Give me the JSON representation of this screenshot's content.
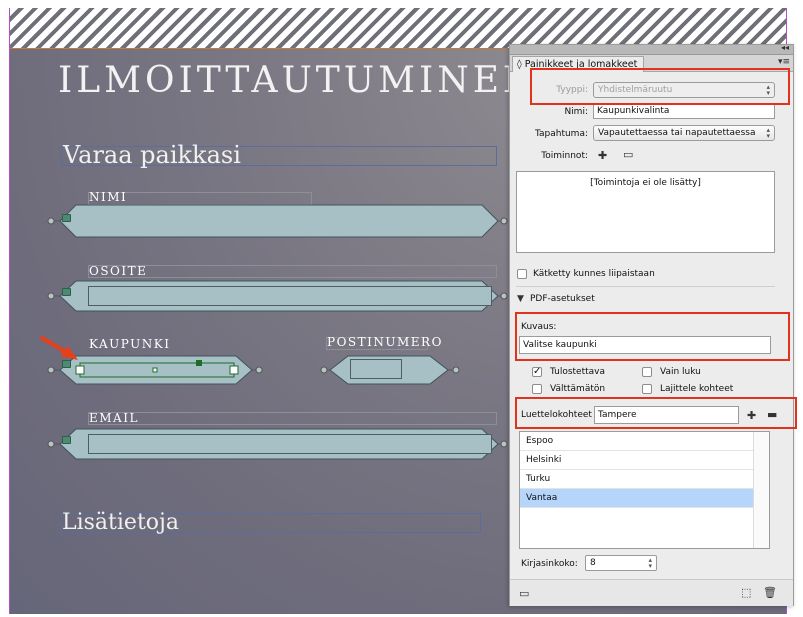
{
  "document": {
    "title": "ILMOITTAUTUMINEN",
    "section_reserve": "Varaa paikkasi",
    "section_more": "Lisätietoja",
    "fields": {
      "name": "NIMI",
      "address": "OSOITE",
      "city": "KAUPUNKI",
      "postal": "POSTINUMERO",
      "email": "EMAIL"
    }
  },
  "panel": {
    "collapse_glyph": "◂◂",
    "tab_label": "◊ Painikkeet ja lomakkeet",
    "menu_glyph": "▾≡",
    "type_label": "Tyyppi:",
    "type_value": "Yhdistelmäruutu",
    "name_label": "Nimi:",
    "name_value": "Kaupunkivalinta",
    "event_label": "Tapahtuma:",
    "event_value": "Vapautettaessa tai napautettaessa",
    "actions_label": "Toiminnot:",
    "actions_empty": "[Toimintoja ei ole lisätty]",
    "hidden_until_label": "Kätketty kunnes liipaistaan",
    "pdf_section": "PDF-asetukset",
    "description_label": "Kuvaus:",
    "description_value": "Valitse kaupunki",
    "printable_label": "Tulostettava",
    "readonly_label": "Vain luku",
    "required_label": "Välttämätön",
    "sort_label": "Lajittele kohteet",
    "list_items_label": "Luettelokohteet",
    "list_item_input": "Tampere",
    "list_items": [
      "Espoo",
      "Helsinki",
      "Turku",
      "Vantaa"
    ],
    "selected_index": 3,
    "font_size_label": "Kirjasinkoko:",
    "font_size_value": "8",
    "printable_checked": true,
    "readonly_checked": false,
    "required_checked": false,
    "sort_checked": false,
    "hidden_checked": false
  },
  "colors": {
    "highlight_red": "#e0321c",
    "field_fill": "#a6c0c6",
    "selection_blue": "#b5d5fb",
    "annotation_arrow": "#e5401c"
  },
  "icons": {
    "add": "plus-icon",
    "remove": "minus-icon",
    "preview": "preview-icon",
    "convert": "convert-object-icon",
    "delete": "trash-icon"
  }
}
